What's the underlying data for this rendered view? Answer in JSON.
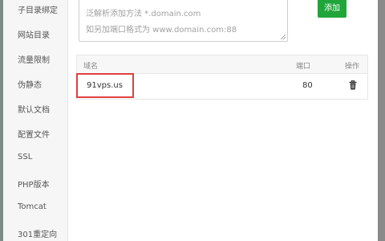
{
  "sidebar": {
    "items": [
      {
        "label": "子目录绑定"
      },
      {
        "label": "网站目录"
      },
      {
        "label": "流量限制"
      },
      {
        "label": "伪静态"
      },
      {
        "label": "默认文档"
      },
      {
        "label": "配置文件"
      },
      {
        "label": "SSL"
      },
      {
        "label": "PHP版本"
      },
      {
        "label": "Tomcat"
      },
      {
        "label": "301重定向"
      }
    ]
  },
  "domain_input": {
    "hint_line1": "泛解析添加方法 *.domain.com",
    "hint_line2": "如另加端口格式为 www.domain.com:88"
  },
  "add_button": {
    "label": "添加"
  },
  "table": {
    "headers": {
      "domain": "域名",
      "port": "端口",
      "action": "操作"
    },
    "rows": [
      {
        "domain": "91vps.us",
        "port": "80",
        "action_icon": "trash-icon"
      }
    ]
  },
  "colors": {
    "accent": "#20a53a",
    "highlight": "#e04040"
  }
}
